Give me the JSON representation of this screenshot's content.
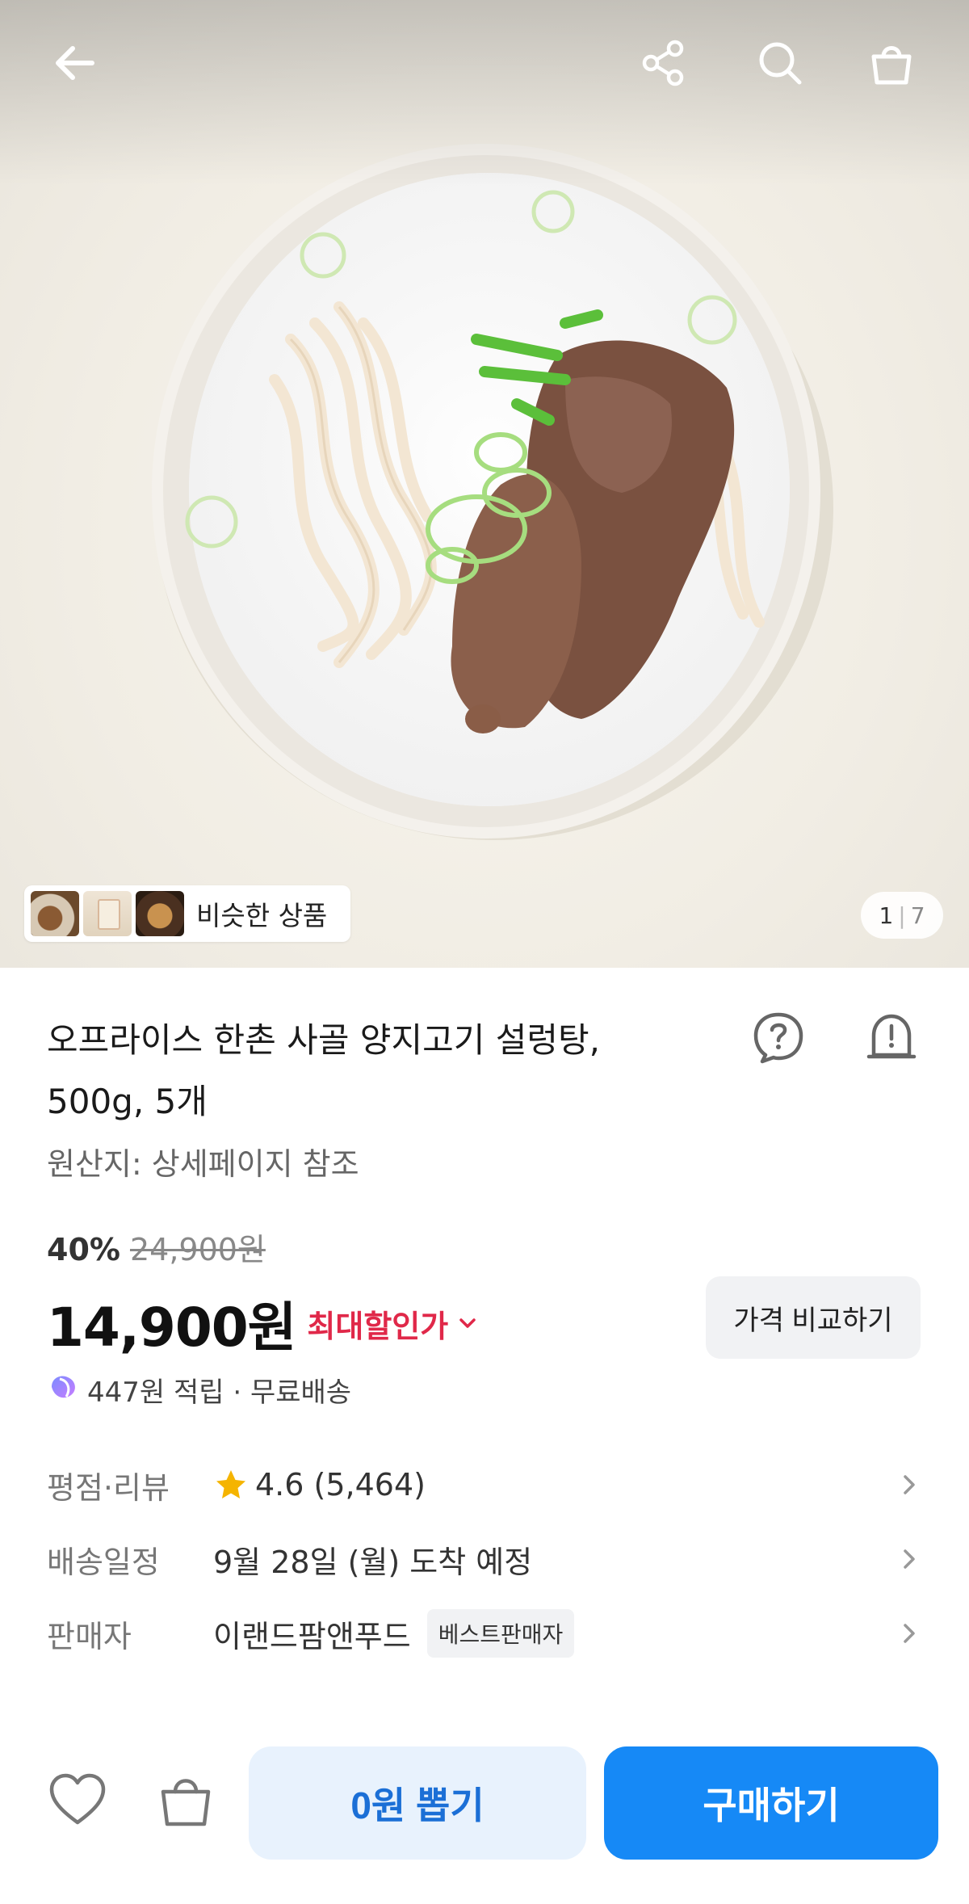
{
  "topbar": {
    "back_icon": "arrow-left-icon",
    "share_icon": "share-icon",
    "search_icon": "search-icon",
    "cart_icon": "shopping-bag-icon"
  },
  "gallery": {
    "similar_label": "비슷한 상품",
    "current_page": "1",
    "page_separator": "|",
    "total_pages": "7"
  },
  "product": {
    "title_line1": "오프라이스 한촌 사골 양지고기 설렁탕,",
    "title_line2": "500g, 5개",
    "question_icon": "question-icon",
    "alarm_icon": "alarm-bell-icon",
    "origin": "원산지: 상세페이지 참조",
    "discount_percent": "40%",
    "original_price": "24,900원",
    "price": "14,900원",
    "max_discount_label": "최대할인가",
    "compare_label": "가격 비교하기",
    "points_text": "447원 적립 · 무료배송"
  },
  "info_rows": {
    "rating": {
      "label": "평점·리뷰",
      "value": "4.6 (5,464)"
    },
    "delivery": {
      "label": "배송일정",
      "value": "9월 28일 (월) 도착 예정"
    },
    "seller": {
      "label": "판매자",
      "value": "이랜드팜앤푸드",
      "badge": "베스트판매자"
    }
  },
  "bottom_bar": {
    "wishlist_icon": "heart-icon",
    "cart_icon": "shopping-bag-icon",
    "zero_won_label": "0원 뽑기",
    "buy_label": "구매하기"
  },
  "colors": {
    "accent_blue": "#1689f6",
    "light_blue": "#e8f2fd",
    "discount_red": "#e02849",
    "star_yellow": "#f5b400"
  }
}
